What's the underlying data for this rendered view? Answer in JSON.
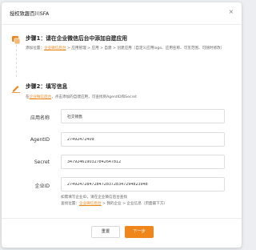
{
  "dialog": {
    "title": "授权致趣百川SFA",
    "close_icon": "×"
  },
  "colors": {
    "accent": "#f08519",
    "text": "#222222"
  },
  "step1": {
    "icon": "card-icon",
    "title": "步骤1：请在企业微信后台中添加自建应用",
    "path_prefix": "添加位置：",
    "path_link": "企业微信后台",
    "path_rest": " > 应用管理 > 应用 > 自建 > 创建应用（自定义应用logo、应用名称、可见范围、可随时修改）"
  },
  "step2": {
    "icon": "pencil-icon",
    "title": "步骤2：填写信息",
    "desc_prefix": "在",
    "desc_link": "企业微信后台",
    "desc_rest": "，点击添加的自建应用，可查找到AgentID和Secret"
  },
  "fields": {
    "app_name": {
      "label": "应用名称",
      "value": "社交销售"
    },
    "agent_id": {
      "label": "AgentID",
      "value": "27492472409"
    },
    "secret": {
      "label": "Secret",
      "value": "3479246190327842647812"
    },
    "corp_id": {
      "label": "企业ID",
      "value": "27492472847284728372834729482394​8"
    }
  },
  "hint": {
    "line1": "如需填写企业ID，请在企业微信后台查找",
    "line2_prefix": "查找位置：",
    "line2_link": "企业微信后台",
    "line2_rest": " > 我的企业 > 企业信息（页面最下方）"
  },
  "footer": {
    "reset_label": "重置",
    "next_label": "下一步"
  }
}
